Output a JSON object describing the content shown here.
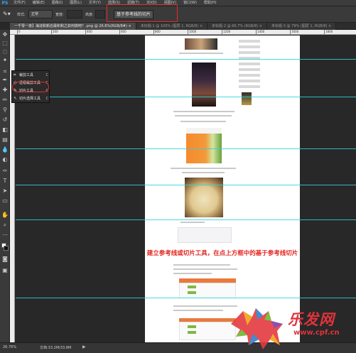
{
  "app": {
    "logo": "PS"
  },
  "menubar": {
    "items": [
      "文件(F)",
      "编辑(E)",
      "图像(I)",
      "图层(L)",
      "文字(Y)",
      "选择(S)",
      "滤镜(T)",
      "3D(D)",
      "视图(V)",
      "窗口(W)",
      "帮助(H)"
    ]
  },
  "options": {
    "tool_icon": "slice-icon",
    "style_label": "样式:",
    "style_value": "正常",
    "width_label": "宽度:",
    "height_label": "高度:",
    "guide_button": "基于参考线的切片"
  },
  "tabs": [
    {
      "label": "一千零一夜】海淀和新店最积和之如何搞吧？.png @ 26.6%(RGB/8#) ×",
      "active": true
    },
    {
      "label": "未标题-1 @ 100% (图层 1, RGB/8) ×",
      "active": false
    },
    {
      "label": "未标题-2 @ 66.7% (RGB/8) ×",
      "active": false
    },
    {
      "label": "未标题-3 @ 79% (图层 1, RGB/8) ×",
      "active": false
    }
  ],
  "ruler": {
    "labels": [
      "0",
      "200",
      "400",
      "600",
      "800",
      "1000",
      "1200",
      "1400",
      "1600",
      "1800"
    ]
  },
  "flyout": {
    "items": [
      {
        "label": "裁剪工具",
        "key": "C",
        "icon": "crop-icon"
      },
      {
        "label": "透视裁剪工具",
        "key": "C",
        "icon": "perspective-crop-icon"
      },
      {
        "label": "切片工具",
        "key": "C",
        "icon": "slice-icon"
      },
      {
        "label": "切片选择工具",
        "key": "C",
        "icon": "slice-select-icon"
      }
    ]
  },
  "annotation": "建立参考线或切片工具，在点上方框中的基于参考线切片",
  "status": {
    "zoom": "26.76%",
    "doc": "文档:33.2M/33.8M",
    "arrow": "▶"
  },
  "watermark": {
    "text": "乐发网",
    "url": "www.cpf.cn"
  },
  "colors": {
    "guide": "#2ad4d8",
    "highlight": "#e62b2b",
    "annotation": "#e3231d",
    "ps_logo": "#31a8ff"
  }
}
